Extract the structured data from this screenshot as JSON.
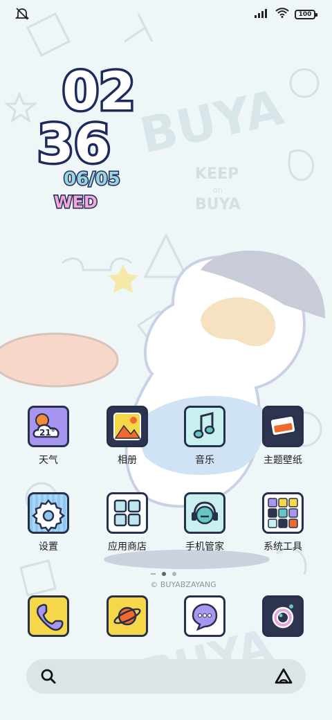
{
  "status_bar": {
    "battery": "100"
  },
  "clock": {
    "hour": "02",
    "minute": "36",
    "date": "06/05",
    "weekday": "WED"
  },
  "weather": {
    "temp": "21°"
  },
  "wallpaper": {
    "watermark": "BUYA",
    "slogan_1": "KEEP",
    "slogan_2": "on",
    "slogan_3": "BUYA",
    "credit": "© BUYABZAYANG"
  },
  "apps_row1": [
    {
      "label": "天气",
      "icon": "weather-icon"
    },
    {
      "label": "相册",
      "icon": "gallery-icon"
    },
    {
      "label": "音乐",
      "icon": "music-icon"
    },
    {
      "label": "主题壁纸",
      "icon": "themes-icon"
    }
  ],
  "apps_row2": [
    {
      "label": "设置",
      "icon": "settings-icon"
    },
    {
      "label": "应用商店",
      "icon": "app-store-icon"
    },
    {
      "label": "手机管家",
      "icon": "security-icon"
    },
    {
      "label": "系统工具",
      "icon": "tools-folder-icon"
    }
  ],
  "dock": [
    {
      "icon": "phone-icon"
    },
    {
      "icon": "browser-icon"
    },
    {
      "icon": "messages-icon"
    },
    {
      "icon": "camera-icon"
    }
  ],
  "colors": {
    "background": "#eef6f8",
    "outline": "#26304a",
    "yellow": "#f7d74a",
    "purple": "#a895f0",
    "mint": "#c9f0ee",
    "navy": "#2c3450",
    "orange": "#f06a2c"
  }
}
